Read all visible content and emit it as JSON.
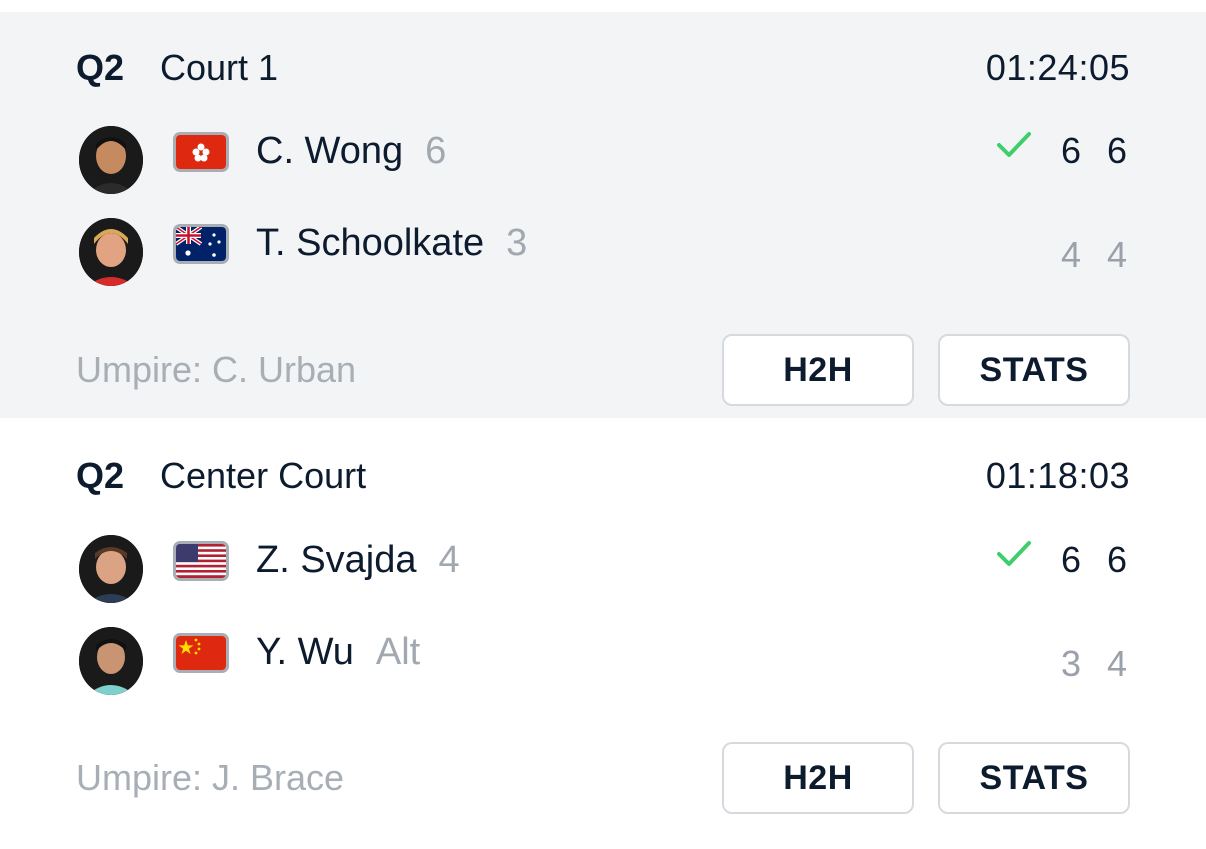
{
  "matches": [
    {
      "round": "Q2",
      "court": "Court 1",
      "clock": "01:24:05",
      "umpire": "Umpire: C. Urban",
      "h2h_label": "H2H",
      "stats_label": "STATS",
      "players": [
        {
          "name": "C. Wong",
          "seed": "6",
          "country": "hong-kong-flag-icon",
          "winner": true,
          "sets": [
            "6",
            "6"
          ]
        },
        {
          "name": "T. Schoolkate",
          "seed": "3",
          "country": "australia-flag-icon",
          "winner": false,
          "sets": [
            "4",
            "4"
          ]
        }
      ]
    },
    {
      "round": "Q2",
      "court": "Center Court",
      "clock": "01:18:03",
      "umpire": "Umpire: J. Brace",
      "h2h_label": "H2H",
      "stats_label": "STATS",
      "players": [
        {
          "name": "Z. Svajda",
          "seed": "4",
          "country": "usa-flag-icon",
          "winner": true,
          "sets": [
            "6",
            "6"
          ]
        },
        {
          "name": "Y. Wu",
          "seed": "Alt",
          "country": "china-flag-icon",
          "winner": false,
          "sets": [
            "3",
            "4"
          ]
        }
      ]
    }
  ],
  "colors": {
    "win_check": "#3ecf6a",
    "muted_text": "#a1a8b0",
    "primary_text": "#0d1b2e",
    "card_bg": "#f3f4f6"
  }
}
